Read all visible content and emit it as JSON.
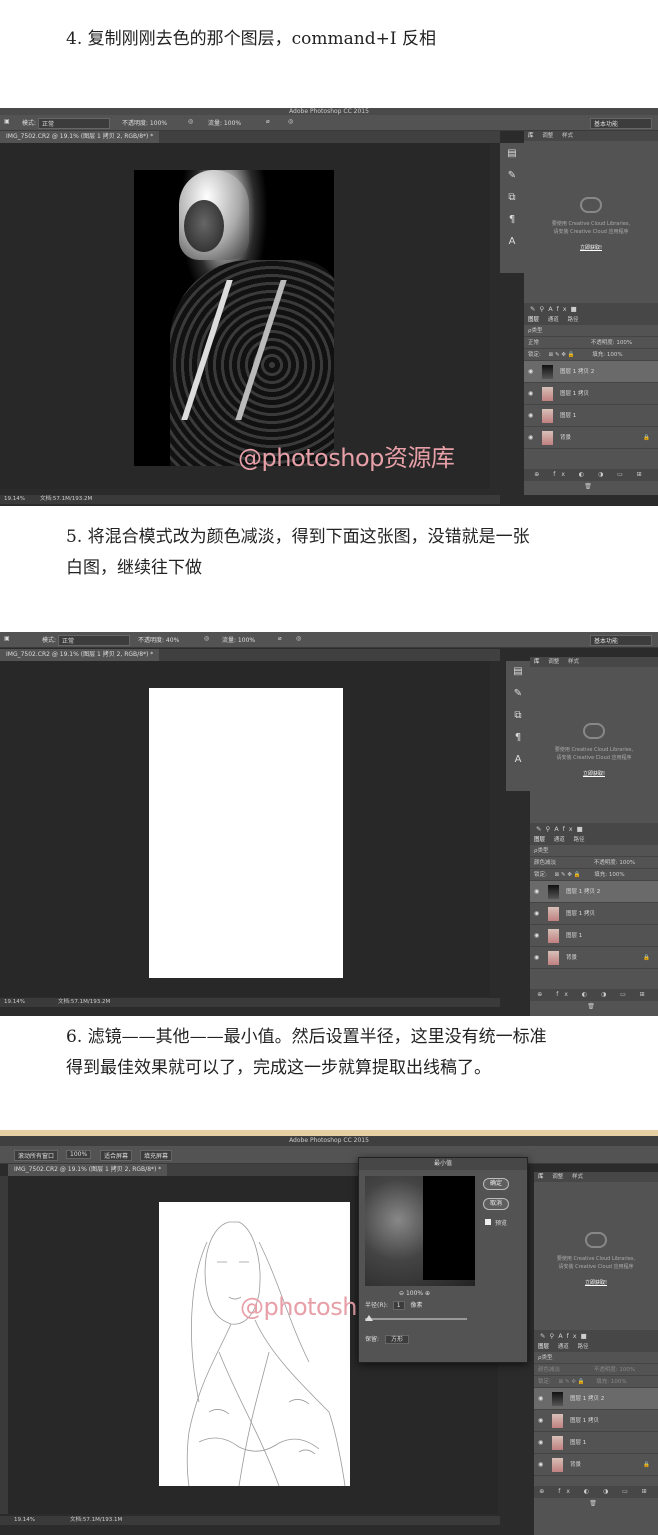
{
  "step4": {
    "text": "4. 复制刚刚去色的那个图层，command+I 反相"
  },
  "step5": {
    "line1": "5. 将混合模式改为颜色减淡，得到下面这张图，没错就是一张",
    "line2": "白图，继续往下做"
  },
  "step6": {
    "line1": "6. 滤镜——其他——最小值。然后设置半径，这里没有统一标准",
    "line2": "得到最佳效果就可以了，完成这一步就算提取出线稿了。"
  },
  "watermark": "@photoshop资源库",
  "app_title": "Adobe Photoshop CC 2015",
  "shot1": {
    "mode_label": "模式:",
    "mode_value": "正常",
    "opacity": "不透明度: 100%",
    "flow": "流量: 100%",
    "workspace": "基本功能",
    "doc_tab": "IMG_7502.CR2 @ 19.1% (图层 1 拷贝 2, RGB/8*) *",
    "status_zoom": "19.14%",
    "status_doc": "文档:57.1M/193.2M",
    "panel_tabs": [
      "库",
      "调整",
      "样式"
    ],
    "library_msg1": "要使用 Creative Cloud Libraries,",
    "library_msg2": "请安装 Creative Cloud 应用程序",
    "library_link": "立即获取!",
    "layer_tabs": [
      "图层",
      "通道",
      "路径"
    ],
    "kind_filter": "ρ类型",
    "blend_mode": "正常",
    "layer_opacity": "不透明度: 100%",
    "lock_label": "锁定:",
    "fill": "填充: 100%",
    "layers": [
      "图层 1 拷贝 2",
      "图层 1 拷贝",
      "图层 1",
      "背景"
    ]
  },
  "shot2": {
    "mode_label": "模式:",
    "mode_value": "正常",
    "opacity": "不透明度: 40%",
    "flow": "流量: 100%",
    "workspace": "基本功能",
    "doc_tab": "IMG_7502.CR2 @ 19.1% (图层 1 拷贝 2, RGB/8*) *",
    "status_zoom": "19.14%",
    "status_doc": "文档:57.1M/193.2M",
    "panel_tabs": [
      "库",
      "调整",
      "样式"
    ],
    "library_msg1": "要使用 Creative Cloud Libraries,",
    "library_msg2": "请安装 Creative Cloud 应用程序",
    "library_link": "立即获取!",
    "layer_tabs": [
      "图层",
      "通道",
      "路径"
    ],
    "kind_filter": "ρ类型",
    "blend_mode": "颜色减淡",
    "layer_opacity": "不透明度: 100%",
    "lock_label": "锁定:",
    "fill": "填充: 100%",
    "layers": [
      "图层 1 拷贝 2",
      "图层 1 拷贝",
      "图层 1",
      "背景"
    ]
  },
  "shot3": {
    "scroll_all": "滚动所有窗口",
    "zoom_value": "100%",
    "fit_screen": "适合屏幕",
    "fill_screen": "填充屏幕",
    "doc_tab": "IMG_7502.CR2 @ 19.1% (图层 1 拷贝 2, RGB/8*) *",
    "status_zoom": "19.14%",
    "status_doc": "文档:57.1M/193.1M",
    "panel_tabs": [
      "库",
      "调整",
      "样式"
    ],
    "library_msg1": "要使用 Creative Cloud Libraries,",
    "library_msg2": "请安装 Creative Cloud 应用程序",
    "library_link": "立即获取!",
    "layer_tabs": [
      "图层",
      "通道",
      "路径"
    ],
    "kind_filter": "ρ类型",
    "blend_mode": "颜色减淡",
    "layer_opacity": "不透明度: 100%",
    "lock_label": "锁定:",
    "fill": "填充: 100%",
    "layers": [
      "图层 1 拷贝 2",
      "图层 1 拷贝",
      "图层 1",
      "背景"
    ],
    "dialog": {
      "title": "最小值",
      "ok": "确定",
      "cancel": "取消",
      "preview": "预览",
      "zoom": "100%",
      "radius_label": "半径(R):",
      "radius_value": "1",
      "radius_unit": "像素",
      "keep_label": "保留:",
      "keep_value": "方形"
    }
  },
  "colors": {
    "ps_bg": "#2b2b2b",
    "panel": "#535353",
    "active_layer": "#6a6a6a",
    "watermark": "#e8a0a8"
  }
}
